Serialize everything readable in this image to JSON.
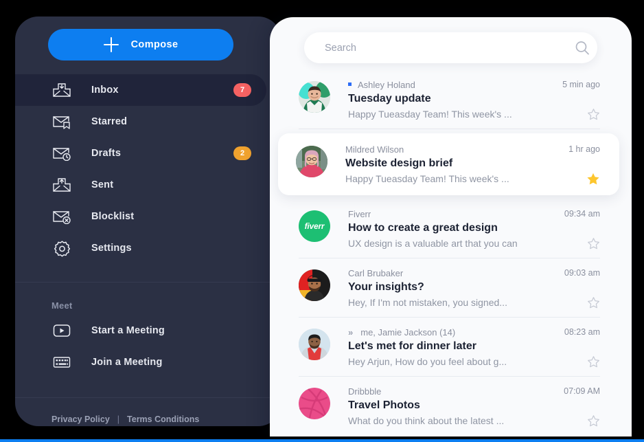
{
  "sidebar": {
    "compose": {
      "label": "Compose",
      "icon": "plus-icon"
    },
    "items": [
      {
        "label": "Inbox",
        "icon": "envelope-download-icon",
        "badge": "7",
        "badge_color": "#f56262",
        "active": true
      },
      {
        "label": "Starred",
        "icon": "envelope-bookmark-icon",
        "badge": "",
        "badge_color": "",
        "active": false
      },
      {
        "label": "Drafts",
        "icon": "envelope-clock-icon",
        "badge": "2",
        "badge_color": "#f0a22e",
        "active": false
      },
      {
        "label": "Sent",
        "icon": "envelope-send-icon",
        "badge": "",
        "badge_color": "",
        "active": false
      },
      {
        "label": "Blocklist",
        "icon": "envelope-block-icon",
        "badge": "",
        "badge_color": "",
        "active": false
      },
      {
        "label": "Settings",
        "icon": "gear-icon",
        "badge": "",
        "badge_color": "",
        "active": false
      }
    ],
    "meet": {
      "section_title": "Meet",
      "items": [
        {
          "label": "Start a Meeting",
          "icon": "video-play-icon"
        },
        {
          "label": "Join a Meeting",
          "icon": "keyboard-icon"
        }
      ]
    },
    "footer": {
      "privacy": "Privacy Policy",
      "separator": "|",
      "terms": "Terms Conditions"
    }
  },
  "search": {
    "placeholder": "Search",
    "value": "",
    "icon": "search-icon"
  },
  "mail": {
    "rows": [
      {
        "sender": "Ashley Holand",
        "subject": "Tuesday update",
        "preview": "Happy Tueasday Team! This week's ...",
        "time": "5 min ago",
        "unread": true,
        "forwarded": false,
        "starred": false,
        "selected": false,
        "avatar_type": "photo",
        "avatar_id": "avatar-ashley"
      },
      {
        "sender": "Mildred Wilson",
        "subject": "Website design brief",
        "preview": "Happy Tueasday Team! This week's ...",
        "time": "1 hr ago",
        "unread": false,
        "forwarded": false,
        "starred": true,
        "selected": true,
        "avatar_type": "photo",
        "avatar_id": "avatar-mildred"
      },
      {
        "sender": "Fiverr",
        "subject": "How to create a great design",
        "preview": "UX design is a valuable art that you can",
        "time": "09:34 am",
        "unread": false,
        "forwarded": false,
        "starred": false,
        "selected": false,
        "avatar_type": "brand",
        "avatar_id": "avatar-fiverr",
        "brand_text": "fiverr",
        "brand_color": "#1dbf73"
      },
      {
        "sender": "Carl Brubaker",
        "subject": "Your insights?",
        "preview": "Hey, If I'm not mistaken, you signed...",
        "time": "09:03 am",
        "unread": false,
        "forwarded": false,
        "starred": false,
        "selected": false,
        "avatar_type": "photo",
        "avatar_id": "avatar-carl"
      },
      {
        "sender": "me, Jamie Jackson (14)",
        "subject": "Let's met for dinner later",
        "preview": "Hey Arjun, How do you feel about g...",
        "time": "08:23 am",
        "unread": false,
        "forwarded": true,
        "forward_glyph": "»",
        "starred": false,
        "selected": false,
        "avatar_type": "photo",
        "avatar_id": "avatar-jamie"
      },
      {
        "sender": "Dribbble",
        "subject": "Travel Photos",
        "preview": "What do you think about the latest ...",
        "time": "07:09 AM",
        "unread": false,
        "forwarded": false,
        "starred": false,
        "selected": false,
        "avatar_type": "brand",
        "avatar_id": "avatar-dribbble",
        "brand_color": "#ea4c89"
      }
    ]
  },
  "colors": {
    "accent": "#0d7ef0",
    "sidebar_bg": "#2b3044",
    "sidebar_active": "#20243a",
    "panel_bg": "#f9fafc",
    "star_active": "#fdc62e",
    "badge_red": "#f56262",
    "badge_orange": "#f0a22e"
  }
}
